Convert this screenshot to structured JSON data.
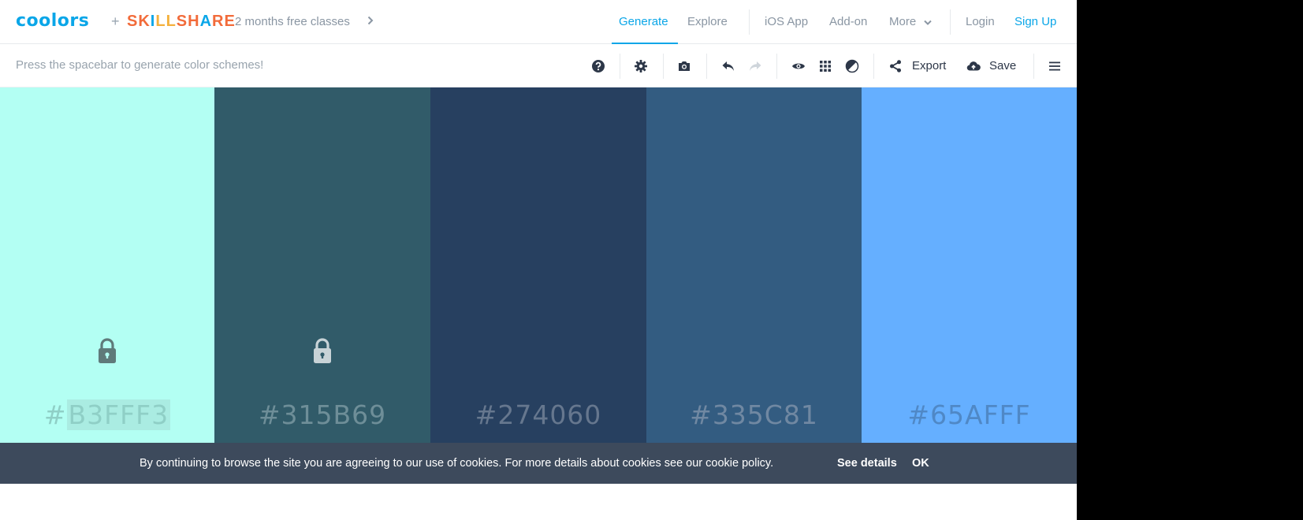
{
  "brand": {
    "logo": "coolors",
    "plus": "+",
    "partner_letters": [
      {
        "ch": "S",
        "color": "#f26b3a"
      },
      {
        "ch": "K",
        "color": "#f26b3a"
      },
      {
        "ch": "I",
        "color": "#0aa6e8"
      },
      {
        "ch": "L",
        "color": "#f4b13d"
      },
      {
        "ch": "L",
        "color": "#f4b13d"
      },
      {
        "ch": "S",
        "color": "#f26b3a"
      },
      {
        "ch": "H",
        "color": "#f26b3a"
      },
      {
        "ch": "A",
        "color": "#0aa6e8"
      },
      {
        "ch": "R",
        "color": "#f26b3a"
      },
      {
        "ch": "E",
        "color": "#f26b3a"
      }
    ],
    "promo": "2 months free classes"
  },
  "nav": {
    "generate": "Generate",
    "explore": "Explore",
    "ios_app": "iOS App",
    "add_on": "Add-on",
    "more": "More",
    "login": "Login",
    "signup": "Sign Up",
    "accent": "#0aa6e8"
  },
  "toolbar": {
    "hint": "Press the spacebar to generate color schemes!",
    "export": "Export",
    "save": "Save",
    "icons": [
      "help-icon",
      "gear-icon",
      "camera-icon",
      "undo-icon",
      "redo-icon",
      "eye-icon",
      "grid-icon",
      "contrast-icon",
      "share-icon",
      "cloud-upload-icon",
      "menu-icon"
    ]
  },
  "palette": [
    {
      "hex": "#B3FFF3",
      "hash": "#",
      "code": "B3FFF3",
      "bg": "#B3FFF3",
      "text_color": "#8fcfc6",
      "locked": true,
      "lock_color": "#5f7a7a"
    },
    {
      "hex": "#315B69",
      "hash": "#",
      "code": "315B69",
      "bg": "#315B69",
      "text_color": "#6e8e98",
      "locked": true,
      "lock_color": "#c8d3d7"
    },
    {
      "hex": "#274060",
      "hash": "#",
      "code": "274060",
      "bg": "#274060",
      "text_color": "#66778e",
      "locked": false
    },
    {
      "hex": "#335C81",
      "hash": "#",
      "code": "335C81",
      "bg": "#335C81",
      "text_color": "#7088a2",
      "locked": false
    },
    {
      "hex": "#65AFFF",
      "hash": "#",
      "code": "65AFFF",
      "bg": "#65AFFF",
      "text_color": "#4f88c6",
      "locked": false
    }
  ],
  "cookie": {
    "text": "By continuing to browse the site you are agreeing to our use of cookies. For more details about cookies see our cookie policy.",
    "details": "See details",
    "ok": "OK"
  }
}
